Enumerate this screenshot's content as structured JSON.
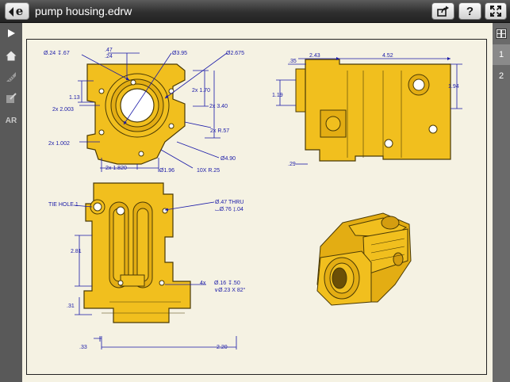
{
  "app": {
    "title": "pump housing.edrw"
  },
  "toolbar": {
    "share_icon": "share-icon",
    "help_label": "?",
    "fullscreen_icon": "fullscreen-icon"
  },
  "left_toolbar": {
    "ar_label": "AR"
  },
  "sheets": [
    "1",
    "2"
  ],
  "colors": {
    "part_fill": "#f1bf1e",
    "part_stroke": "#4a3a05",
    "dim": "#1a1aa8",
    "paper": "#f5f2e3",
    "chrome": "#595959"
  },
  "drawing": {
    "front_view": {
      "dims": [
        "Ø.24 ↧.67",
        ".47",
        ".24",
        "Ø3.95",
        "Ø2.675",
        "1.13",
        "2x 2.003",
        "2x 1.002",
        "2x 1.70",
        "2x 3.40",
        "2x R.57",
        "Ø4.90",
        "2x 1.820",
        "Ø1.96",
        "10X R.25"
      ]
    },
    "side_view": {
      "dims": [
        "2.43",
        "4.52",
        ".35",
        "1.94",
        "1.19",
        ".29"
      ]
    },
    "bottom_view": {
      "dims": [
        "TIE HOLE 1",
        "Ø.47 THRU",
        "⌴Ø.76 ↧.04",
        "2.81",
        "4x",
        "Ø.16 ↧.50",
        "∨Ø.23 X 82°",
        ".31",
        ".33",
        "2.20"
      ]
    }
  }
}
